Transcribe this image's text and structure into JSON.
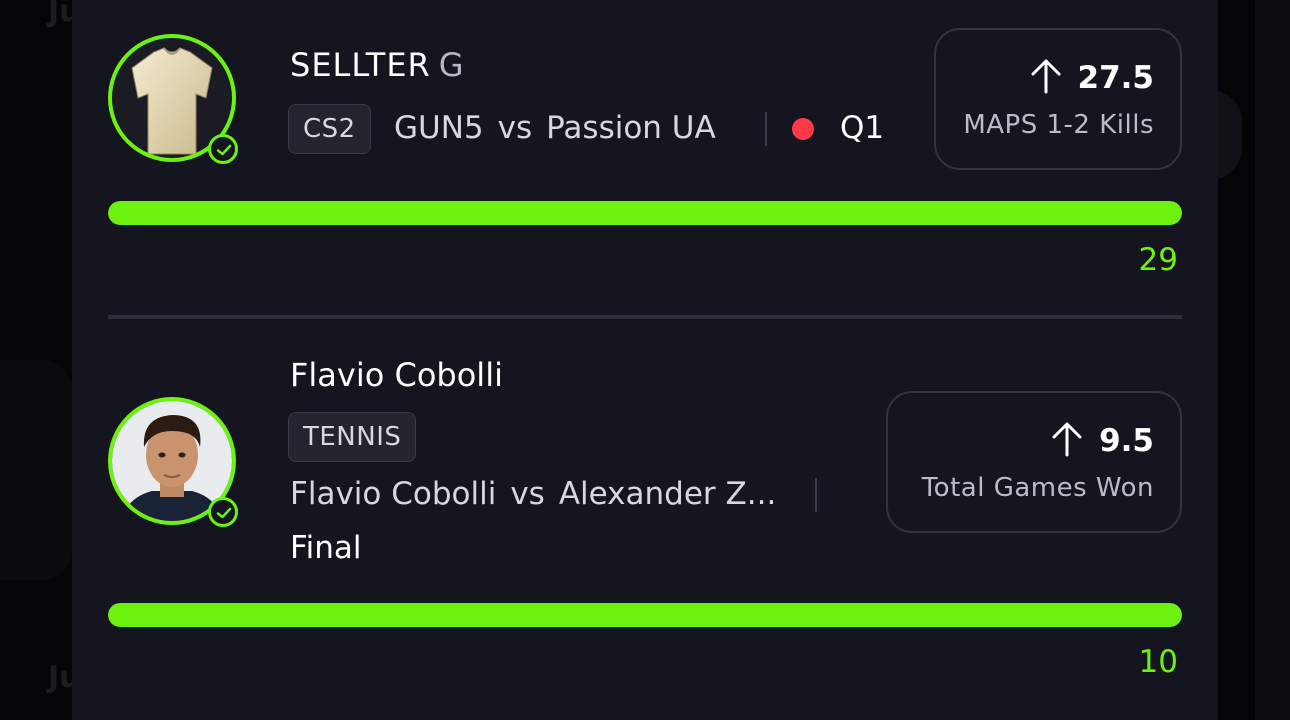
{
  "background": {
    "ghost_text_top": "Ju",
    "ghost_text_bottom": "Ju"
  },
  "picks": [
    {
      "player_name": "SELLTER",
      "position": "G",
      "avatar_icon": "jersey-icon",
      "sport_tag": "CS2",
      "team_home": "GUN5",
      "vs_label": "vs",
      "team_away": "Passion UA",
      "live": true,
      "status": "Q1",
      "direction_icon": "arrow-up-icon",
      "line_value": "27.5",
      "stat_label": "MAPS 1-2 Kills",
      "progress_fraction": 1.0,
      "result_value": "29"
    },
    {
      "player_name": "Flavio Cobolli",
      "avatar_icon": "player-photo",
      "sport_tag": "TENNIS",
      "team_home": "Flavio Cobolli",
      "vs_label": "vs",
      "team_away": "Alexander Z...",
      "status": "Final",
      "direction_icon": "arrow-up-icon",
      "line_value": "9.5",
      "stat_label": "Total Games Won",
      "progress_fraction": 1.0,
      "result_value": "10"
    }
  ],
  "colors": {
    "accent_green": "#6cf20e",
    "live_red": "#ff3b47",
    "panel": "#15151f"
  }
}
